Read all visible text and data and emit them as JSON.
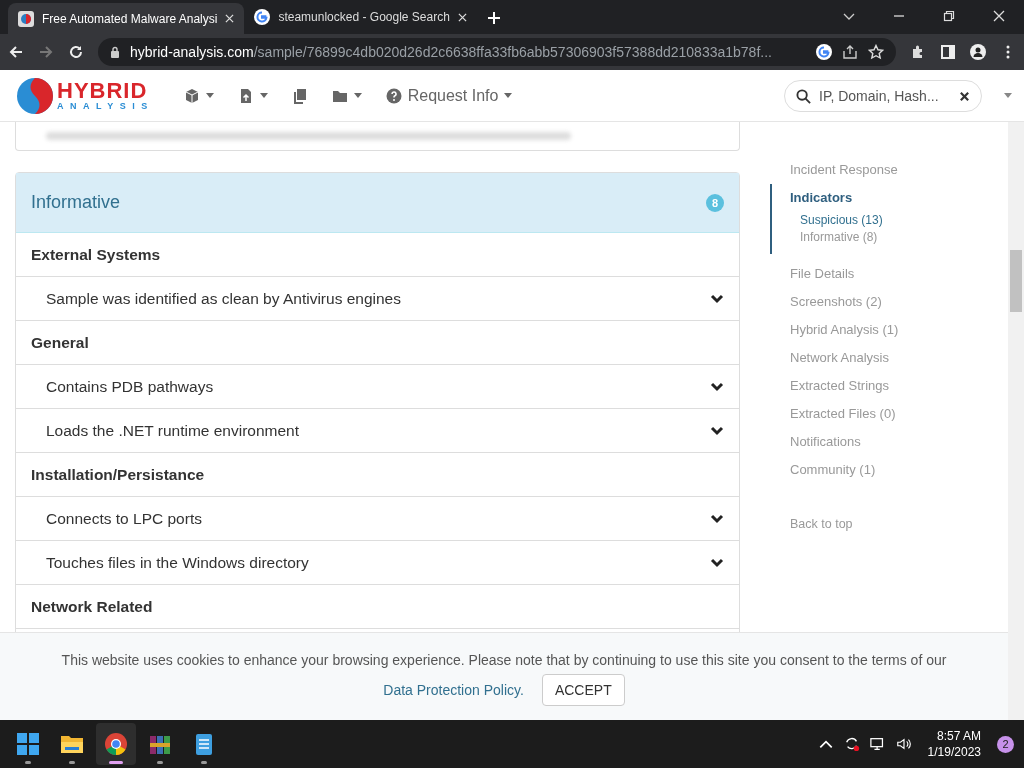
{
  "browser": {
    "tabs": [
      {
        "title": "Free Automated Malware Analysi",
        "selected": true,
        "kind": "site"
      },
      {
        "title": "steamunlocked - Google Search",
        "selected": false,
        "kind": "google"
      }
    ],
    "url_host": "hybrid-analysis.com",
    "url_path": "/sample/76899c4db020d26d2c6638ffa33fb6abb57306903f57388dd210833a1b78f..."
  },
  "site_header": {
    "logo_top": "HYBRID",
    "logo_bottom": "ANALYSIS",
    "nav_label": "Request Info",
    "search": {
      "placeholder": "IP, Domain, Hash..."
    }
  },
  "informative": {
    "title": "Informative",
    "count": "8",
    "groups": [
      {
        "name": "External Systems",
        "items": [
          "Sample was identified as clean by Antivirus engines"
        ]
      },
      {
        "name": "General",
        "items": [
          "Contains PDB pathways",
          "Loads the .NET runtime environment"
        ]
      },
      {
        "name": "Installation/Persistance",
        "items": [
          "Connects to LPC ports",
          "Touches files in the Windows directory"
        ]
      },
      {
        "name": "Network Related"
      }
    ]
  },
  "sidebar": {
    "items": [
      {
        "label": "Incident Response",
        "selected": false
      },
      {
        "label": "Indicators",
        "selected": true,
        "children": [
          {
            "label": "Suspicious (13)",
            "selected": true
          },
          {
            "label": "Informative (8)",
            "selected": false
          }
        ]
      },
      {
        "label": "File Details",
        "selected": false
      },
      {
        "label": "Screenshots (2)",
        "selected": false
      },
      {
        "label": "Hybrid Analysis (1)",
        "selected": false
      },
      {
        "label": "Network Analysis",
        "selected": false
      },
      {
        "label": "Extracted Strings",
        "selected": false
      },
      {
        "label": "Extracted Files (0)",
        "selected": false
      },
      {
        "label": "Notifications",
        "selected": false
      },
      {
        "label": "Community (1)",
        "selected": false
      }
    ],
    "back_to_top": "Back to top"
  },
  "cookie_banner": {
    "text": "This website uses cookies to enhance your browsing experience. Please note that by continuing to use this site you consent to the terms of our",
    "link": "Data Protection Policy.",
    "button": "ACCEPT"
  },
  "taskbar": {
    "apps": [
      {
        "kind": "start",
        "selected": false
      },
      {
        "kind": "explorer",
        "selected": false
      },
      {
        "kind": "chrome",
        "selected": true
      },
      {
        "kind": "archive",
        "selected": false
      },
      {
        "kind": "notepad",
        "selected": false
      }
    ],
    "time": "8:57 AM",
    "date": "1/19/2023",
    "notifications": "2"
  }
}
